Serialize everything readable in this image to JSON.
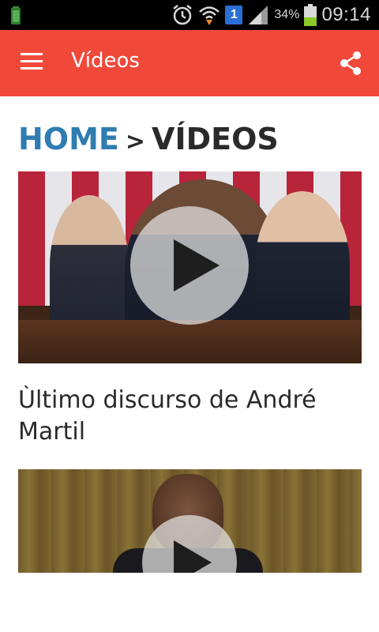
{
  "status_bar": {
    "battery_percent": "34%",
    "time": "09:14",
    "notification_badge": "1",
    "icons": [
      "battery-saver-icon",
      "alarm-icon",
      "wifi-icon",
      "notification-badge-icon",
      "signal-icon",
      "battery-icon"
    ]
  },
  "app_bar": {
    "title": "Vídeos",
    "menu_icon": "hamburger-menu-icon",
    "share_icon": "share-icon",
    "color": "#f0493a"
  },
  "breadcrumb": {
    "home": "HOME",
    "separator": ">",
    "current": "VÍDEOS",
    "home_color": "#2f7cb1"
  },
  "videos": [
    {
      "title": "Ùltimo discurso de André Martil",
      "play_icon": "play-icon"
    },
    {
      "title": "",
      "play_icon": "play-icon"
    }
  ]
}
